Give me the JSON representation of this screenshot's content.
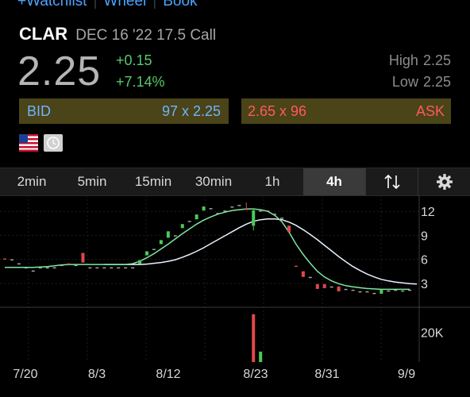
{
  "nav": {
    "watchlist": "+Watchlist",
    "wheel": "Wheel",
    "book": "Book"
  },
  "header": {
    "symbol": "CLAR",
    "description": "DEC 16 '22 17.5 Call"
  },
  "quote": {
    "last": "2.25",
    "change": "+0.15",
    "change_pct": "+7.14%",
    "high_label": "High",
    "high_value": "2.25",
    "low_label": "Low",
    "low_value": "2.25"
  },
  "bid": {
    "label": "BID",
    "value": "97 x 2.25"
  },
  "ask": {
    "label": "ASK",
    "value": "2.65 x 96"
  },
  "icons": {
    "flag": "us-flag-icon",
    "clock": "clock-icon",
    "sort": "sort-arrows-icon",
    "settings": "gear-icon"
  },
  "tabs": [
    {
      "label": "2min",
      "active": false
    },
    {
      "label": "5min",
      "active": false
    },
    {
      "label": "15min",
      "active": false
    },
    {
      "label": "30min",
      "active": false
    },
    {
      "label": "1h",
      "active": false
    },
    {
      "label": "4h",
      "active": true
    }
  ],
  "chart_data": {
    "type": "candlestick",
    "price_ticks": [
      "12",
      "9",
      "6",
      "3"
    ],
    "price_tick_values": [
      12,
      9,
      6,
      3
    ],
    "price_range": [
      0.5,
      14
    ],
    "volume_tick": "20K",
    "volume_tick_value": 20000,
    "volume_range": [
      0,
      34000
    ],
    "x_labels": [
      "7/20",
      "8/3",
      "8/12",
      "8/23",
      "8/31",
      "9/9"
    ],
    "candles": [
      {
        "o": 6.1,
        "c": 6.1,
        "h": 6.1,
        "l": 6.1,
        "col": "red"
      },
      {
        "o": 6.0,
        "c": 6.0,
        "h": 6.0,
        "l": 6.0,
        "col": "gray"
      },
      {
        "o": 5.5,
        "c": 5.5,
        "h": 5.5,
        "l": 5.5,
        "col": "gray"
      },
      {
        "o": 5.0,
        "c": 5.0,
        "h": 5.0,
        "l": 5.0,
        "col": "gray"
      },
      {
        "o": 4.6,
        "c": 4.6,
        "h": 4.6,
        "l": 4.6,
        "col": "gray"
      },
      {
        "o": 5.0,
        "c": 5.0,
        "h": 5.0,
        "l": 5.0,
        "col": "gray"
      },
      {
        "o": 5.0,
        "c": 5.0,
        "h": 5.0,
        "l": 5.0,
        "col": "gray"
      },
      {
        "o": 5.0,
        "c": 5.0,
        "h": 5.0,
        "l": 5.0,
        "col": "gray"
      },
      {
        "o": 5.3,
        "c": 5.3,
        "h": 5.3,
        "l": 5.3,
        "col": "gray"
      },
      {
        "o": 5.5,
        "c": 5.5,
        "h": 5.5,
        "l": 5.5,
        "col": "red"
      },
      {
        "o": 5.3,
        "c": 5.3,
        "h": 5.3,
        "l": 5.3,
        "col": "gray"
      },
      {
        "o": 5.6,
        "c": 6.8,
        "h": 6.8,
        "l": 5.6,
        "col": "red"
      },
      {
        "o": 5.0,
        "c": 5.0,
        "h": 5.0,
        "l": 5.0,
        "col": "gray"
      },
      {
        "o": 5.0,
        "c": 5.0,
        "h": 5.0,
        "l": 5.0,
        "col": "gray"
      },
      {
        "o": 5.0,
        "c": 5.0,
        "h": 5.0,
        "l": 5.0,
        "col": "gray"
      },
      {
        "o": 5.0,
        "c": 5.0,
        "h": 5.0,
        "l": 5.0,
        "col": "gray"
      },
      {
        "o": 5.0,
        "c": 5.0,
        "h": 5.0,
        "l": 5.0,
        "col": "gray"
      },
      {
        "o": 5.0,
        "c": 5.0,
        "h": 5.0,
        "l": 5.0,
        "col": "gray"
      },
      {
        "o": 5.0,
        "c": 5.0,
        "h": 5.0,
        "l": 5.0,
        "col": "gray"
      },
      {
        "o": 5.4,
        "c": 5.9,
        "h": 5.9,
        "l": 5.4,
        "col": "green"
      },
      {
        "o": 6.5,
        "c": 7.0,
        "h": 7.0,
        "l": 6.5,
        "col": "green"
      },
      {
        "o": 7.3,
        "c": 7.3,
        "h": 7.3,
        "l": 7.3,
        "col": "gray"
      },
      {
        "o": 7.9,
        "c": 8.4,
        "h": 8.4,
        "l": 7.9,
        "col": "green"
      },
      {
        "o": 8.7,
        "c": 9.5,
        "h": 9.5,
        "l": 8.7,
        "col": "green"
      },
      {
        "o": 9.0,
        "c": 9.0,
        "h": 9.0,
        "l": 9.0,
        "col": "gray"
      },
      {
        "o": 9.9,
        "c": 10.4,
        "h": 10.4,
        "l": 9.9,
        "col": "green"
      },
      {
        "o": 10.8,
        "c": 10.8,
        "h": 10.8,
        "l": 10.8,
        "col": "gray"
      },
      {
        "o": 11.0,
        "c": 11.6,
        "h": 11.6,
        "l": 11.0,
        "col": "green"
      },
      {
        "o": 12.1,
        "c": 12.6,
        "h": 12.6,
        "l": 12.1,
        "col": "green"
      },
      {
        "o": 12.4,
        "c": 12.4,
        "h": 12.4,
        "l": 12.4,
        "col": "gray"
      },
      {
        "o": 11.8,
        "c": 11.8,
        "h": 11.8,
        "l": 11.8,
        "col": "gray"
      },
      {
        "o": 12.1,
        "c": 12.1,
        "h": 12.1,
        "l": 12.1,
        "col": "gray"
      },
      {
        "o": 12.6,
        "c": 12.6,
        "h": 12.6,
        "l": 12.6,
        "col": "gray"
      },
      {
        "o": 12.8,
        "c": 12.8,
        "h": 12.8,
        "l": 12.8,
        "col": "gray"
      },
      {
        "o": 12.3,
        "c": 12.3,
        "h": 13.1,
        "l": 12.3,
        "col": "red"
      },
      {
        "o": 10.2,
        "c": 12.1,
        "h": 12.3,
        "l": 9.6,
        "col": "green"
      },
      {
        "o": 12.1,
        "c": 12.1,
        "h": 12.1,
        "l": 12.1,
        "col": "gray"
      },
      {
        "o": 12.1,
        "c": 12.1,
        "h": 12.1,
        "l": 12.1,
        "col": "gray"
      },
      {
        "o": 11.7,
        "c": 11.7,
        "h": 11.7,
        "l": 11.7,
        "col": "gray"
      },
      {
        "o": 11.2,
        "c": 11.2,
        "h": 11.2,
        "l": 11.2,
        "col": "gray"
      },
      {
        "o": 10.2,
        "c": 9.4,
        "h": 10.2,
        "l": 9.4,
        "col": "red"
      },
      {
        "o": 5.2,
        "c": 5.2,
        "h": 5.2,
        "l": 5.2,
        "col": "red"
      },
      {
        "o": 4.5,
        "c": 3.8,
        "h": 4.5,
        "l": 3.8,
        "col": "red"
      },
      {
        "o": 3.8,
        "c": 3.8,
        "h": 3.8,
        "l": 3.8,
        "col": "gray"
      },
      {
        "o": 2.9,
        "c": 2.3,
        "h": 2.9,
        "l": 2.3,
        "col": "red"
      },
      {
        "o": 2.9,
        "c": 2.4,
        "h": 2.9,
        "l": 2.4,
        "col": "red"
      },
      {
        "o": 2.6,
        "c": 2.6,
        "h": 2.6,
        "l": 2.6,
        "col": "gray"
      },
      {
        "o": 2.6,
        "c": 2.0,
        "h": 2.6,
        "l": 2.0,
        "col": "red"
      },
      {
        "o": 2.3,
        "c": 2.3,
        "h": 2.3,
        "l": 2.3,
        "col": "gray"
      },
      {
        "o": 2.2,
        "c": 2.2,
        "h": 2.2,
        "l": 2.2,
        "col": "gray"
      },
      {
        "o": 2.0,
        "c": 2.0,
        "h": 2.0,
        "l": 2.0,
        "col": "gray"
      },
      {
        "o": 2.0,
        "c": 2.0,
        "h": 2.0,
        "l": 2.0,
        "col": "gray"
      },
      {
        "o": 1.8,
        "c": 1.8,
        "h": 1.8,
        "l": 1.8,
        "col": "gray"
      },
      {
        "o": 1.7,
        "c": 2.2,
        "h": 2.2,
        "l": 1.7,
        "col": "green"
      },
      {
        "o": 2.1,
        "c": 2.1,
        "h": 2.1,
        "l": 2.1,
        "col": "gray"
      },
      {
        "o": 2.2,
        "c": 2.2,
        "h": 2.2,
        "l": 2.2,
        "col": "gray"
      },
      {
        "o": 2.1,
        "c": 2.1,
        "h": 2.1,
        "l": 2.1,
        "col": "gray"
      },
      {
        "o": 2.2,
        "c": 2.2,
        "h": 2.2,
        "l": 2.2,
        "col": "gray"
      }
    ],
    "volumes": [
      {
        "i": 35,
        "v": 32000,
        "col": "red"
      },
      {
        "i": 36,
        "v": 7000,
        "col": "green"
      }
    ],
    "ma_fast": [
      5.0,
      5.0,
      5.0,
      5.0,
      5.0,
      5.05,
      5.1,
      5.2,
      5.3,
      5.35,
      5.35,
      5.35,
      5.35,
      5.35,
      5.35,
      5.35,
      5.35,
      5.35,
      5.45,
      5.75,
      6.2,
      6.7,
      7.3,
      7.9,
      8.55,
      9.2,
      9.8,
      10.4,
      10.9,
      11.3,
      11.65,
      11.9,
      12.1,
      12.2,
      12.3,
      12.3,
      12.2,
      12.0,
      11.5,
      10.7,
      9.4,
      7.9,
      6.6,
      5.5,
      4.5,
      3.8,
      3.3,
      2.95,
      2.7,
      2.55,
      2.45,
      2.35,
      2.3,
      2.25,
      2.25,
      2.25,
      2.25,
      2.25
    ],
    "ma_slow": [
      5.35,
      5.35,
      5.35,
      5.35,
      5.35,
      5.35,
      5.4,
      5.5,
      5.6,
      5.75,
      5.95,
      6.25,
      6.6,
      7.0,
      7.45,
      7.95,
      8.45,
      8.95,
      9.45,
      9.95,
      10.4,
      10.75,
      10.95,
      11.05,
      11.05,
      10.95,
      10.65,
      10.25,
      9.7,
      9.1,
      8.45,
      7.75,
      7.05,
      6.35,
      5.7,
      5.1,
      4.6,
      4.15,
      3.8,
      3.5,
      3.3,
      3.15,
      3.05,
      2.95,
      2.9
    ]
  }
}
